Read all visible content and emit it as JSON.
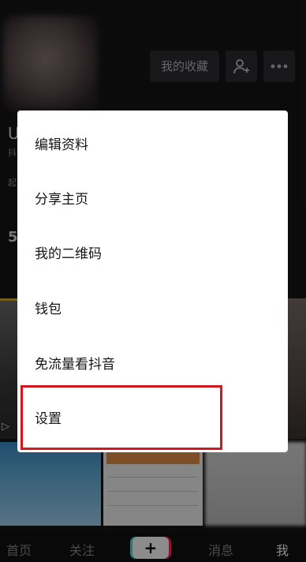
{
  "profile": {
    "favorites_label": "我的收藏",
    "add_friend_icon": "add-user-icon",
    "more_icon": "more-icon",
    "peek_name": "U",
    "peek_line1": "抖",
    "peek_line2": "起",
    "peek_count": "5"
  },
  "menu": {
    "items": [
      {
        "label": "编辑资料"
      },
      {
        "label": "分享主页"
      },
      {
        "label": "我的二维码"
      },
      {
        "label": "钱包"
      },
      {
        "label": "免流量看抖音"
      },
      {
        "label": "设置"
      }
    ],
    "highlighted": "设置"
  },
  "bottom_nav": {
    "home": "首页",
    "follow": "关注",
    "plus": "+",
    "messages": "消息",
    "me": "我"
  },
  "colors": {
    "highlight": "#d6161d",
    "menu_bg": "#ffffff",
    "page_bg": "#151517"
  }
}
